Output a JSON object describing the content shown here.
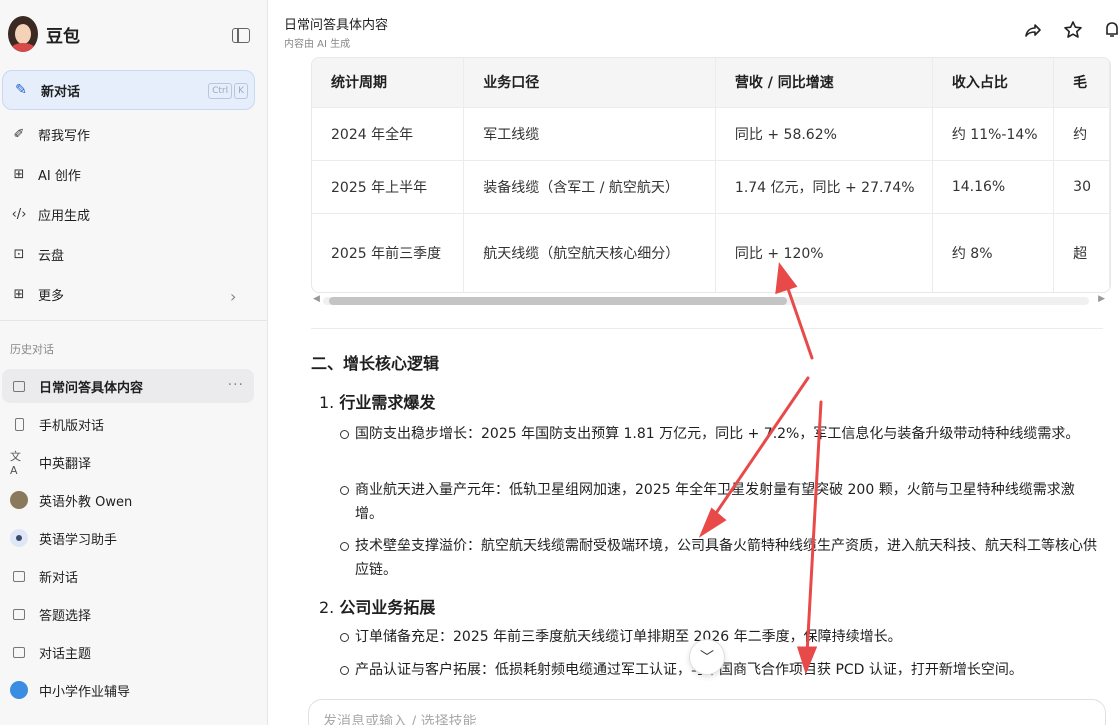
{
  "sidebar": {
    "brand": "豆包",
    "new_chat": {
      "label": "新对话",
      "shortcut": [
        "Ctrl",
        "K"
      ]
    },
    "menu": [
      {
        "label": "帮我写作",
        "icon": "pen-icon"
      },
      {
        "label": "AI 创作",
        "icon": "image-create-icon"
      },
      {
        "label": "应用生成",
        "icon": "code-icon"
      },
      {
        "label": "云盘",
        "icon": "cloud-drive-icon"
      },
      {
        "label": "更多",
        "icon": "grid-icon"
      }
    ],
    "history_title": "历史对话",
    "history": [
      {
        "label": "日常问答具体内容",
        "icon": "chat-icon",
        "active": true
      },
      {
        "label": "手机版对话",
        "icon": "phone-icon"
      },
      {
        "label": "中英翻译",
        "icon": "translate-icon"
      },
      {
        "label": "英语外教 Owen",
        "icon": "avatar-icon"
      },
      {
        "label": "英语学习助手",
        "icon": "assistant-icon"
      },
      {
        "label": "新对话",
        "icon": "chat-icon"
      },
      {
        "label": "答题选择",
        "icon": "chat-icon"
      },
      {
        "label": "对话主题",
        "icon": "chat-icon"
      },
      {
        "label": "中小学作业辅导",
        "icon": "globe-icon"
      }
    ]
  },
  "header": {
    "title": "日常问答具体内容",
    "subtitle": "内容由 AI 生成",
    "icons": [
      "share-icon",
      "star-icon",
      "bell-icon"
    ]
  },
  "table": {
    "headers": [
      "统计周期",
      "业务口径",
      "营收 / 同比增速",
      "收入占比",
      "毛"
    ],
    "rows": [
      [
        "2024 年全年",
        "军工线缆",
        "同比 + 58.62%",
        "约 11%-14%",
        "约"
      ],
      [
        "2025 年上半年",
        "装备线缆（含军工 / 航空航天）",
        "1.74 亿元，同比 + 27.74%",
        "14.16%",
        "30"
      ],
      [
        "2025 年前三季度",
        "航天线缆（航空航天核心细分）",
        "同比 + 120%",
        "约 8%",
        "超"
      ]
    ]
  },
  "content": {
    "section_title": "二、增长核心逻辑",
    "groups": [
      {
        "num": "1.",
        "title": "行业需求爆发",
        "items": [
          "国防支出稳步增长：2025 年国防支出预算 1.81 万亿元，同比 + 7.2%，军工信息化与装备升级带动特种线缆需求。",
          "商业航天进入量产元年：低轨卫星组网加速，2025 年全年卫星发射量有望突破 200 颗，火箭与卫星特种线缆需求激增。",
          "技术壁垒支撑溢价：航空航天线缆需耐受极端环境，公司具备火箭特种线缆生产资质，进入航天科技、航天科工等核心供应链。"
        ]
      },
      {
        "num": "2.",
        "title": "公司业务拓展",
        "items": [
          "订单储备充足：2025 年前三季度航天线缆订单排期至 2026 年二季度，保障持续增长。",
          "产品认证与客户拓展：低损耗射频电缆通过军工认证，与中国商飞合作项目获 PCD 认证，打开新增长空间。"
        ]
      }
    ]
  },
  "composer": {
    "placeholder": "发消息或输入 / 选择技能"
  },
  "colors": {
    "accent": "#1f5fd1",
    "annotation": "#e84a4a",
    "active_bg": "#e6eefc"
  }
}
